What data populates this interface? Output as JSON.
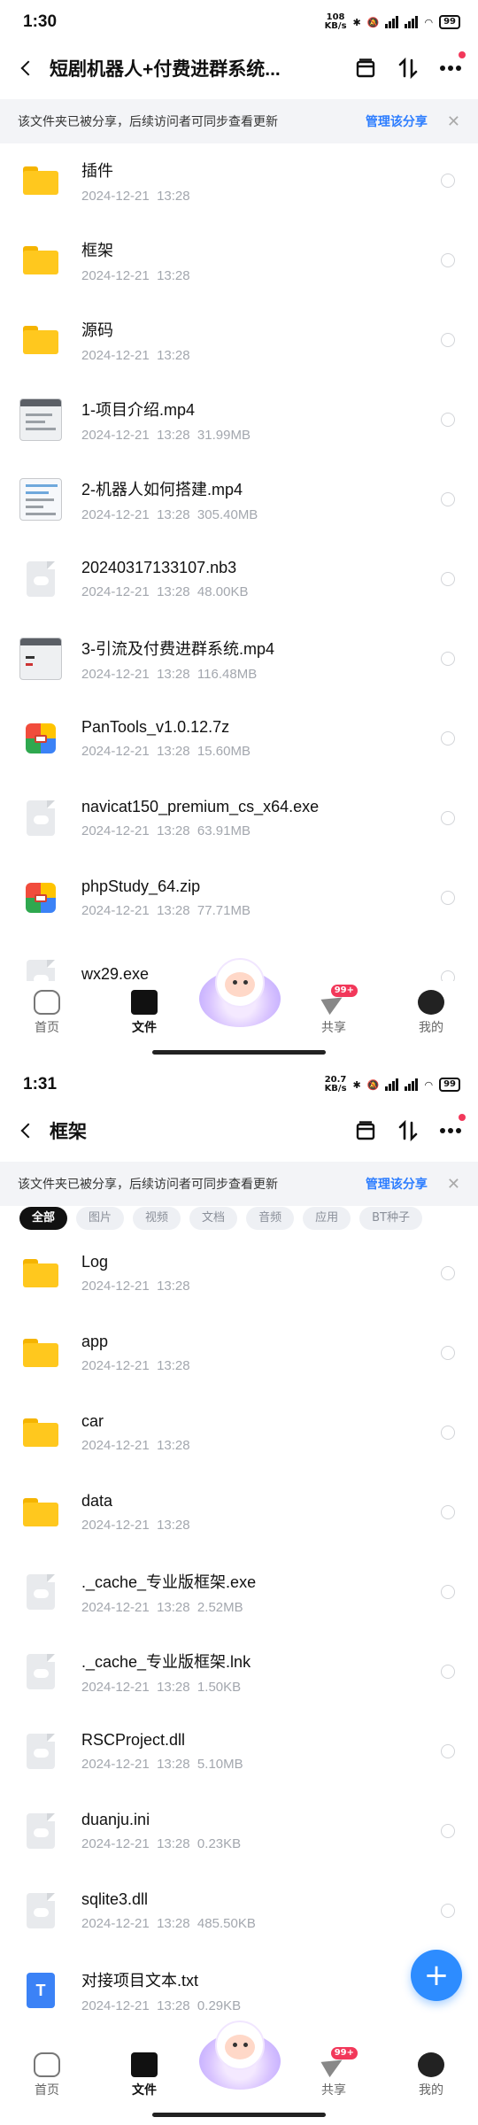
{
  "screens": [
    {
      "status": {
        "time": "1:30",
        "speed_value": "108",
        "speed_unit": "KB/s",
        "battery": "99"
      },
      "header": {
        "title": "短剧机器人+付费进群系统..."
      },
      "banner": {
        "text": "该文件夹已被分享，后续访问者可同步查看更新",
        "link": "管理该分享"
      },
      "files": [
        {
          "name": "插件",
          "meta": "2024-12-21  13:28",
          "icon": "folder"
        },
        {
          "name": "框架",
          "meta": "2024-12-21  13:28",
          "icon": "folder"
        },
        {
          "name": "源码",
          "meta": "2024-12-21  13:28",
          "icon": "folder"
        },
        {
          "name": "1-项目介绍.mp4",
          "meta": "2024-12-21  13:28  31.99MB",
          "icon": "video-thumb"
        },
        {
          "name": "2-机器人如何搭建.mp4",
          "meta": "2024-12-21  13:28  305.40MB",
          "icon": "video-thumb"
        },
        {
          "name": "20240317133107.nb3",
          "meta": "2024-12-21  13:28  48.00KB",
          "icon": "generic-file"
        },
        {
          "name": "3-引流及付费进群系统.mp4",
          "meta": "2024-12-21  13:28  116.48MB",
          "icon": "video-thumb"
        },
        {
          "name": "PanTools_v1.0.12.7z",
          "meta": "2024-12-21  13:28  15.60MB",
          "icon": "archive"
        },
        {
          "name": "navicat150_premium_cs_x64.exe",
          "meta": "2024-12-21  13:28  63.91MB",
          "icon": "generic-file"
        },
        {
          "name": "phpStudy_64.zip",
          "meta": "2024-12-21  13:28  77.71MB",
          "icon": "archive"
        },
        {
          "name": "wx29.exe",
          "meta": "",
          "icon": "generic-file"
        }
      ],
      "tabbar": {
        "home": "首页",
        "files": "文件",
        "share": "共享",
        "share_badge": "99+",
        "me": "我的"
      }
    },
    {
      "status": {
        "time": "1:31",
        "speed_value": "20.7",
        "speed_unit": "KB/s",
        "battery": "99"
      },
      "header": {
        "title": "框架"
      },
      "banner": {
        "text": "该文件夹已被分享，后续访问者可同步查看更新",
        "link": "管理该分享"
      },
      "filters": [
        "全部",
        "图片",
        "视频",
        "文档",
        "音频",
        "应用",
        "BT种子"
      ],
      "files": [
        {
          "name": "Log",
          "meta": "2024-12-21  13:28",
          "icon": "folder"
        },
        {
          "name": "app",
          "meta": "2024-12-21  13:28",
          "icon": "folder"
        },
        {
          "name": "car",
          "meta": "2024-12-21  13:28",
          "icon": "folder"
        },
        {
          "name": "data",
          "meta": "2024-12-21  13:28",
          "icon": "folder"
        },
        {
          "name": "._cache_专业版框架.exe",
          "meta": "2024-12-21  13:28  2.52MB",
          "icon": "generic-file"
        },
        {
          "name": "._cache_专业版框架.lnk",
          "meta": "2024-12-21  13:28  1.50KB",
          "icon": "generic-file"
        },
        {
          "name": "RSCProject.dll",
          "meta": "2024-12-21  13:28  5.10MB",
          "icon": "generic-file"
        },
        {
          "name": "duanju.ini",
          "meta": "2024-12-21  13:28  0.23KB",
          "icon": "generic-file"
        },
        {
          "name": "sqlite3.dll",
          "meta": "2024-12-21  13:28  485.50KB",
          "icon": "generic-file"
        },
        {
          "name": "对接项目文本.txt",
          "meta": "2024-12-21  13:28  0.29KB",
          "icon": "text-file",
          "glyph": "T"
        }
      ],
      "tabbar": {
        "home": "首页",
        "files": "文件",
        "share": "共享",
        "share_badge": "99+",
        "me": "我的"
      },
      "fab": "+"
    }
  ]
}
